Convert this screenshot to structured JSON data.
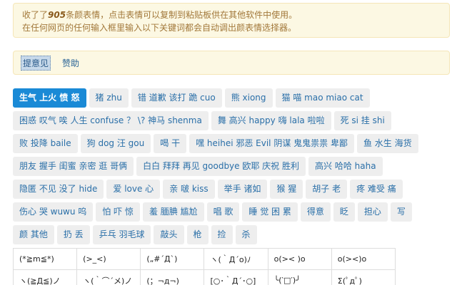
{
  "notice": {
    "line1_prefix": "收了了",
    "line1_count": "905",
    "line1_suffix": "条颜表情，点击表情可以复制到粘贴板供在其他软件中使用。",
    "line2": "在任何网页的任何输入框里输入以下关键词都会自动调出颜表情选择器。"
  },
  "links": [
    {
      "label": "提意见",
      "active": true
    },
    {
      "label": "赞助",
      "active": false
    }
  ],
  "tag_rows": [
    [
      "生气 上火 愤 怒",
      "猪 zhu",
      "错 道歉 该打 跪 cuo",
      "熊 xiong",
      "猫 喵 mao miao cat"
    ],
    [
      "困惑 叹气 唉 人生 confuse ？ \\? 神马 shenma",
      "舞 高兴 happy 嗨 lala 啦啦",
      "死 si 挂 shi"
    ],
    [
      "败 投降 baile",
      "狗 dog 汪 gou",
      "喝 干",
      "嘿 heihei 邪恶 Evil 阴谋 鬼鬼祟祟 卑鄙",
      "鱼 水生 海货"
    ],
    [
      "朋友 握手 闺蜜 亲密 逛 哥俩",
      "白白 拜拜 再见 goodbye 欧耶 庆祝 胜利",
      "高兴 哈哈 haha"
    ],
    [
      "隐匿 不见 没了 hide",
      "爱 love 心",
      "亲 啵 kiss",
      "举手 诸如",
      "猴 猩",
      "胡子 老",
      "疼 难受 痛"
    ],
    [
      "伤心 哭 wuwu 呜",
      "怕 吓 惊",
      "羞 腼腆 尴尬",
      "唱 歌",
      "睡 觉 困 累",
      "得意",
      "眨",
      "担心",
      "写"
    ],
    [
      "颜 其他",
      "扔 丢",
      "乒乓 羽毛球",
      "敲头",
      "枪",
      "捡",
      "杀"
    ]
  ],
  "emoticon_rows": [
    [
      "(*≧m≦*)",
      "(>_<)",
      "(„#´Д`)",
      "ヽ(｀Д´ο)ﾉ",
      "o(>< )o",
      "ο(><)o"
    ],
    [
      "ヽ(≧Д≦)ノ",
      "ヽ(｀⌒´メ)ノ",
      "(；¬д¬)",
      "[○･｀Д´･○]",
      "╰(‵□′)╯",
      "Σ(ﾟдﾟ)"
    ]
  ]
}
